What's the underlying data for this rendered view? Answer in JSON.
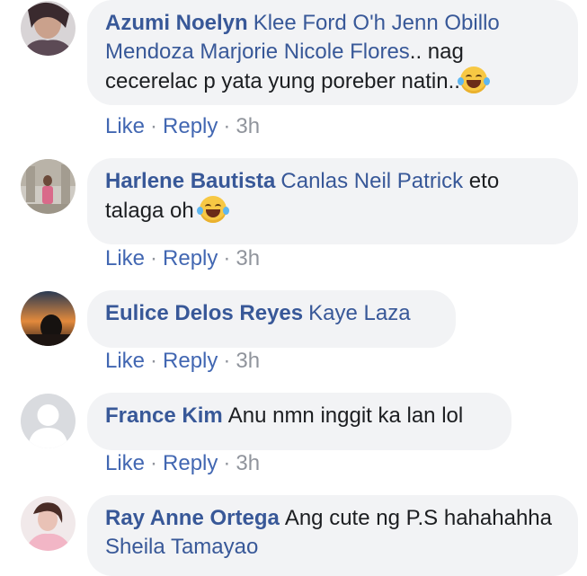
{
  "comments": [
    {
      "author": "Azumi Noelyn",
      "mentions": "Klee Ford O'h Jenn Obillo Mendoza Marjorie Nicole Flores",
      "text": ".. nag cecerelac p yata yung poreber natin..",
      "emoji": "laughing-tears-icon",
      "like": "Like",
      "reply": "Reply",
      "time": "3h"
    },
    {
      "author": "Harlene Bautista",
      "mentions": "Canlas Neil Patrick",
      "text": " eto talaga oh ",
      "emoji": "laughing-tears-icon",
      "like": "Like",
      "reply": "Reply",
      "time": "3h"
    },
    {
      "author": "Eulice Delos Reyes",
      "mentions": "Kaye Laza",
      "text": "",
      "like": "Like",
      "reply": "Reply",
      "time": "3h"
    },
    {
      "author": "France Kim",
      "mentions": "",
      "text": "Anu nmn inggit ka lan lol",
      "like": "Like",
      "reply": "Reply",
      "time": "3h"
    },
    {
      "author": "Ray Anne Ortega",
      "mentions": "",
      "text": "Ang cute ng P.S hahahahha ",
      "mentions_after": "Sheila Tamayao"
    }
  ],
  "separator": "·",
  "colors": {
    "link": "#385898",
    "action": "#4267b2",
    "meta": "#90949c",
    "bubble": "#f2f3f5"
  }
}
